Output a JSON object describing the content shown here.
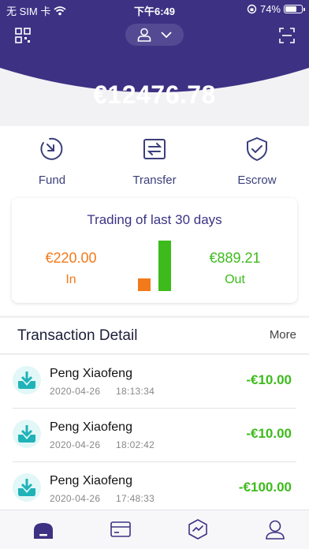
{
  "status_bar": {
    "carrier": "无 SIM 卡",
    "time": "下午6:49",
    "battery": "74%",
    "battery_level": 0.74
  },
  "header": {
    "balance": "€12476.78",
    "icons": [
      "qr-code-icon",
      "user-icon",
      "chevron-down-icon",
      "scan-icon"
    ],
    "accent_color": "#3d3184"
  },
  "actions": [
    {
      "label": "Fund",
      "icon": "fund-icon"
    },
    {
      "label": "Transfer",
      "icon": "transfer-icon"
    },
    {
      "label": "Escrow",
      "icon": "escrow-icon"
    }
  ],
  "trading": {
    "title": "Trading of last 30 days",
    "in_amount": "€220.00",
    "in_label": "In",
    "out_amount": "€889.21",
    "out_label": "Out",
    "in_value": 220.0,
    "out_value": 889.21,
    "in_color": "#f27a1a",
    "out_color": "#3dbb1c"
  },
  "transactions": {
    "title": "Transaction Detail",
    "more": "More",
    "items": [
      {
        "name": "Peng Xiaofeng",
        "date": "2020-04-26",
        "time": "18:13:34",
        "amount": "-€10.00"
      },
      {
        "name": "Peng Xiaofeng",
        "date": "2020-04-26",
        "time": "18:02:42",
        "amount": "-€10.00"
      },
      {
        "name": "Peng Xiaofeng",
        "date": "2020-04-26",
        "time": "17:48:33",
        "amount": "-€100.00"
      }
    ]
  },
  "tabbar": {
    "tabs": [
      "home-icon",
      "card-icon",
      "chart-icon",
      "profile-icon"
    ],
    "active": "home-icon"
  }
}
